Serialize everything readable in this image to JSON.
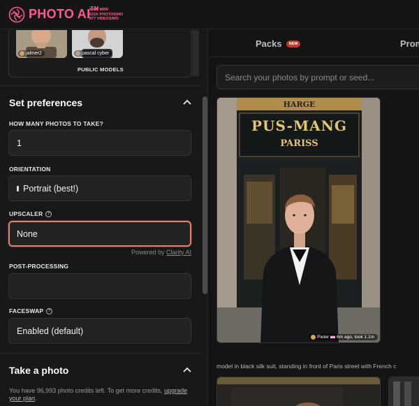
{
  "header": {
    "brand": "PHOTO AI",
    "trademark": "TM",
    "stats": [
      "$56K MRR",
      "631K PHOTOS/MO",
      "877 VIDEOS/MO"
    ],
    "brand_color": "#ff5d8f"
  },
  "models": {
    "items": [
      {
        "name": "jalmer2"
      },
      {
        "name": "pascal cyber"
      }
    ],
    "section_label": "PUBLIC MODELS"
  },
  "preferences": {
    "title": "Set preferences",
    "photos_label": "HOW MANY PHOTOS TO TAKE?",
    "photos_value": "1",
    "orientation_label": "ORIENTATION",
    "orientation_value": "Portrait (best!)",
    "upscaler_label": "UPSCALER",
    "upscaler_value": "None",
    "powered_prefix": "Powered by",
    "powered_link": "Clarity AI",
    "postprocessing_label": "POST-PROCESSING",
    "postprocessing_value": "",
    "faceswap_label": "FACESWAP",
    "faceswap_value": "Enabled (default)",
    "help_glyph": "?"
  },
  "take_photo": {
    "title": "Take a photo",
    "credits_text": "You have 96,993 photo credits left. To get more credits,",
    "credits_link": "upgrade your plan",
    "credits_end": "."
  },
  "gallery": {
    "tabs": [
      {
        "label": "Packs",
        "badge": "NEW"
      },
      {
        "label": "Prom"
      }
    ],
    "search_placeholder": "Search your photos by prompt or seed...",
    "photo": {
      "sign_top": "HARGE",
      "sign_main": "PUS-MANG",
      "sign_sub": "PARISS",
      "author": "Pieter",
      "meta": "6m ago, took 1.1m"
    },
    "caption": "model in black silk suit, standing in front of Paris street with French c"
  },
  "colors": {
    "accent_focus": "#e07f6c",
    "badge_red": "#c0392b"
  }
}
